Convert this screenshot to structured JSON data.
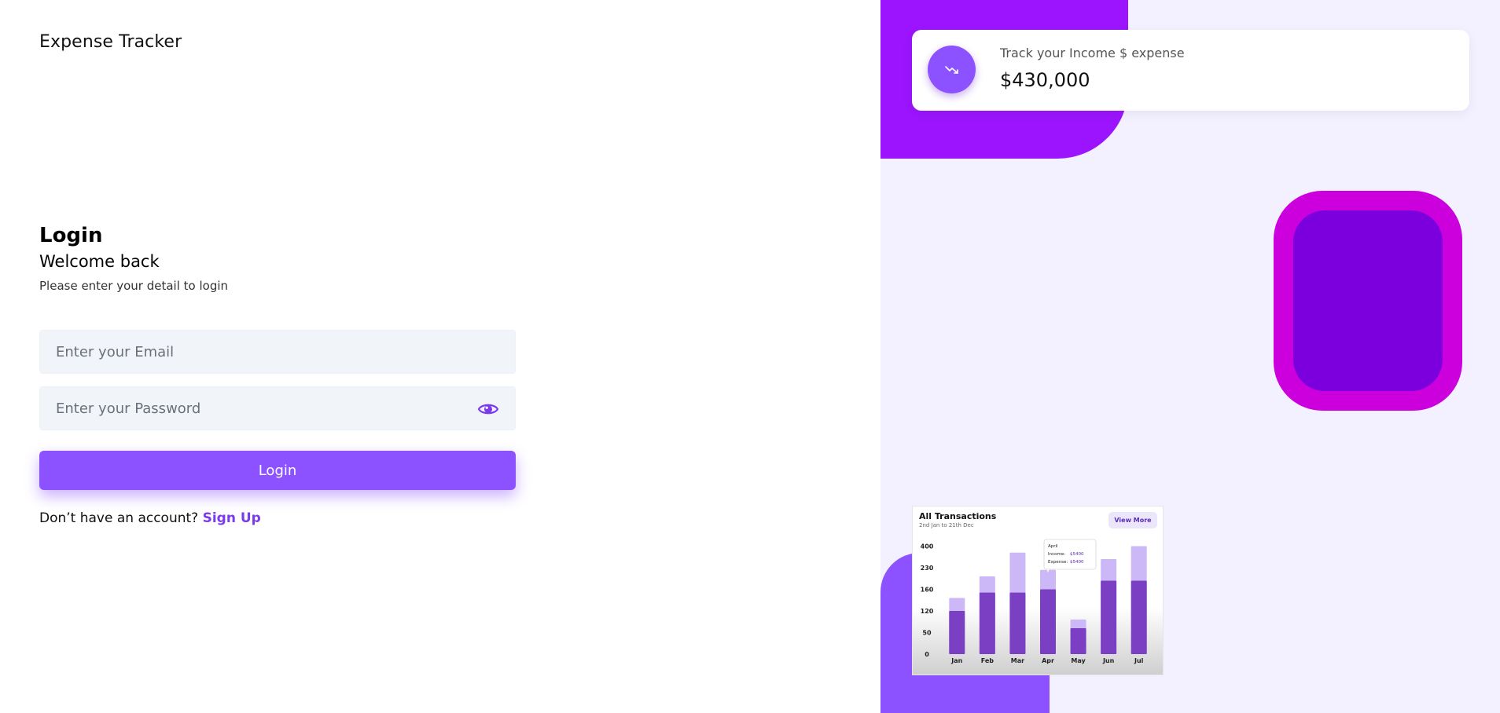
{
  "app": {
    "title": "Expense Tracker"
  },
  "login": {
    "heading": "Login",
    "welcome": "Welcome back",
    "subtitle": "Please enter your detail to login",
    "email_placeholder": "Enter your Email",
    "password_placeholder": "Enter your Password",
    "button_label": "Login",
    "signup_prompt": "Don’t have an account?",
    "signup_link": "Sign Up"
  },
  "icons": {
    "password_toggle": "eye-icon",
    "stat": "trending-down-icon"
  },
  "stat_card": {
    "label": "Track your Income $ expense",
    "value": "$430,000"
  },
  "colors": {
    "primary": "#8c52ff",
    "link": "#7c3aed",
    "panel_bg": "#f3f0ff",
    "blob_purple": "#9b14fd",
    "blob_magenta": "#cc00dd",
    "blob_violet": "#7c00dd",
    "bar_income": "#7b3fc4",
    "bar_expense": "#cdb8f7"
  },
  "chart_card": {
    "title": "All Transactions",
    "subtitle": "2nd Jan to 21th Dec",
    "button": "View More",
    "tooltip": {
      "month": "April",
      "income_label": "Income",
      "income_value": "$5400",
      "expense_label": "Expense",
      "expense_value": "$5400"
    }
  },
  "chart_data": {
    "type": "bar",
    "categories": [
      "Jan",
      "Feb",
      "Mar",
      "Apr",
      "May",
      "Jun",
      "Jul"
    ],
    "y_tick_labels": [
      "0",
      "50",
      "120",
      "160",
      "230",
      "400"
    ],
    "series": [
      {
        "values": [
          2.0,
          2.85,
          2.85,
          3.0,
          1.2,
          3.4,
          3.4
        ]
      },
      {
        "values": [
          2.6,
          3.6,
          4.7,
          3.9,
          1.6,
          4.4,
          5.0
        ]
      }
    ],
    "stacked_total_series_index": 1,
    "tick_positions": [
      0,
      1,
      2,
      3,
      4,
      5
    ],
    "ylim": [
      0,
      5.2
    ],
    "grid": false
  }
}
